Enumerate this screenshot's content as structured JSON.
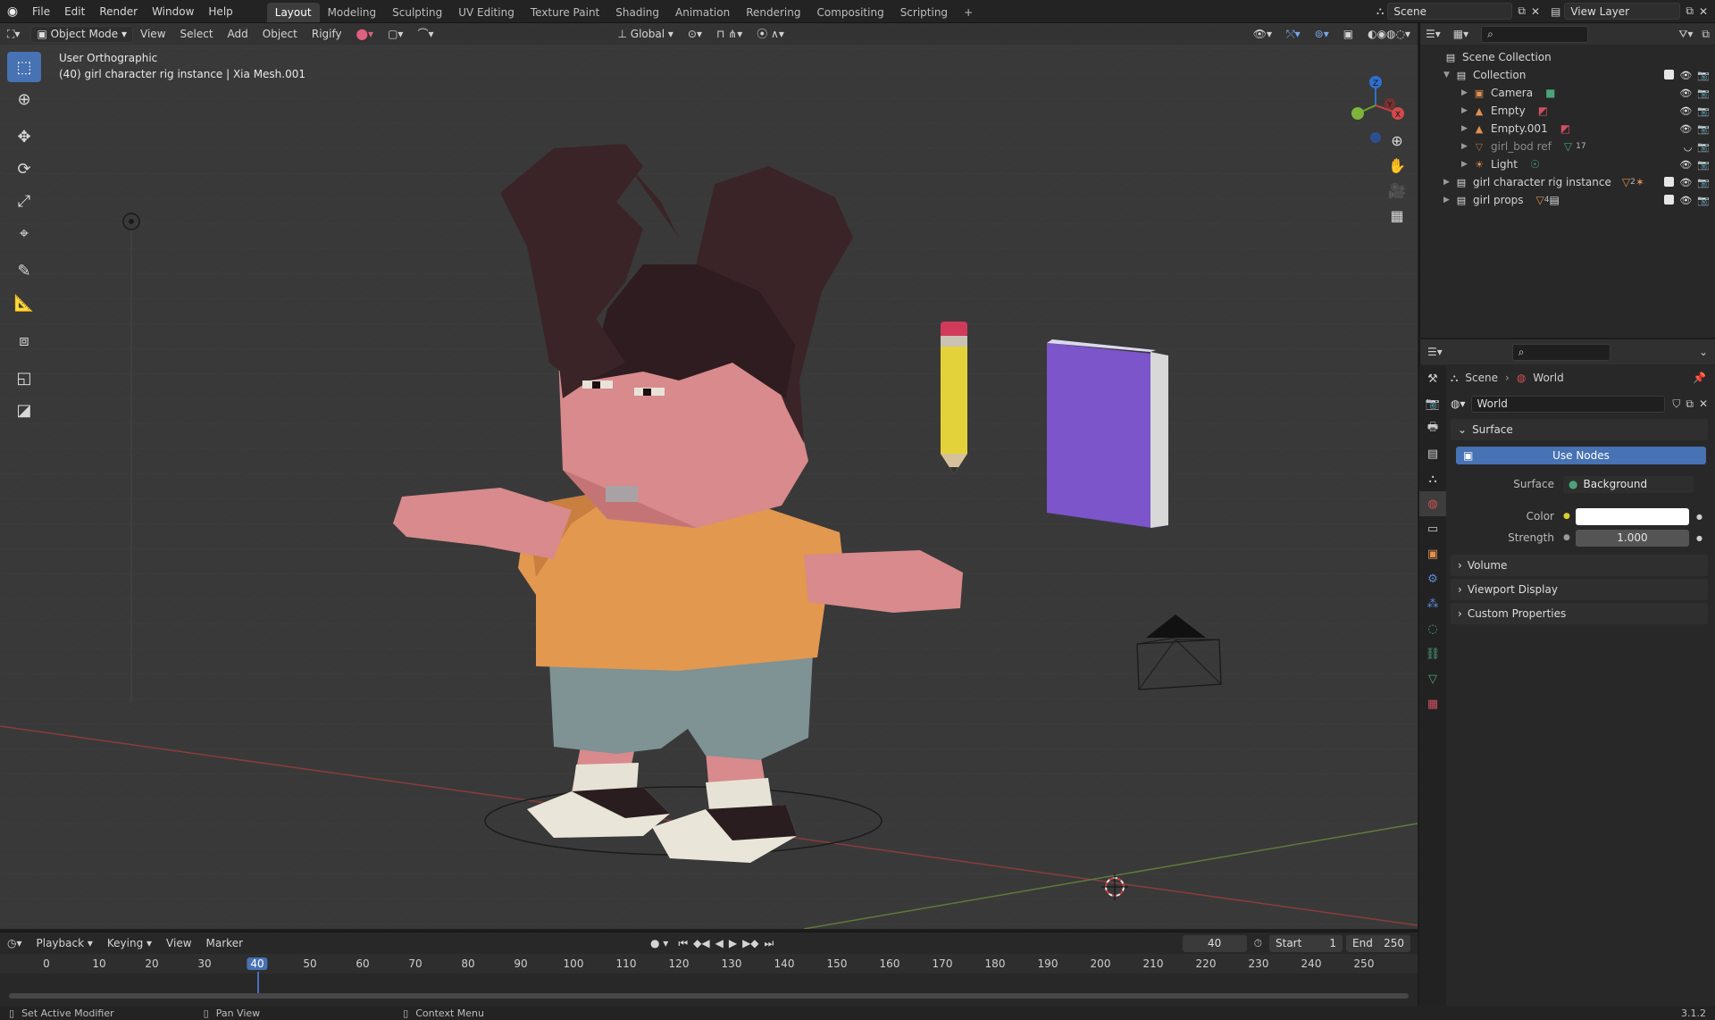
{
  "topbar": {
    "menus": [
      "File",
      "Edit",
      "Render",
      "Window",
      "Help"
    ],
    "workspaces": [
      "Layout",
      "Modeling",
      "Sculpting",
      "UV Editing",
      "Texture Paint",
      "Shading",
      "Animation",
      "Rendering",
      "Compositing",
      "Scripting"
    ],
    "active_workspace": "Layout",
    "add_workspace": "+",
    "scene": "Scene",
    "view_layer": "View Layer"
  },
  "viewport": {
    "mode": "Object Mode",
    "menus": [
      "View",
      "Select",
      "Add",
      "Object",
      "Rigify"
    ],
    "orientation": "Global",
    "view_name": "User Orthographic",
    "object_info": "(40) girl character rig instance | Xia Mesh.001",
    "gizmo": {
      "x": "X",
      "y": "Y",
      "z": "Z"
    }
  },
  "outliner": {
    "root": "Scene Collection",
    "items": [
      {
        "label": "Collection",
        "icon": "collection-icon",
        "level": 1,
        "expanded": true
      },
      {
        "label": "Camera",
        "icon": "camera-icon",
        "level": 2
      },
      {
        "label": "Empty",
        "icon": "empty-icon",
        "level": 2
      },
      {
        "label": "Empty.001",
        "icon": "empty-icon",
        "level": 2
      },
      {
        "label": "girl_bod ref",
        "icon": "mesh-icon",
        "level": 2,
        "badge": "17"
      },
      {
        "label": "Light",
        "icon": "light-icon",
        "level": 2
      },
      {
        "label": "girl character rig instance",
        "icon": "collection-icon",
        "level": 1,
        "badge": "2"
      },
      {
        "label": "girl props",
        "icon": "collection-icon",
        "level": 1,
        "badge": "4"
      }
    ]
  },
  "properties": {
    "breadcrumb": [
      "Scene",
      "World"
    ],
    "world_name": "World",
    "surface_panel": "Surface",
    "use_nodes": "Use Nodes",
    "surface_label": "Surface",
    "surface_value": "Background",
    "color_label": "Color",
    "color_value": "#ffffff",
    "strength_label": "Strength",
    "strength_value": "1.000",
    "panels": [
      "Volume",
      "Viewport Display",
      "Custom Properties"
    ]
  },
  "timeline": {
    "menus": [
      "Playback",
      "Keying",
      "View",
      "Marker"
    ],
    "current_frame": "40",
    "start_label": "Start",
    "start": "1",
    "end_label": "End",
    "end": "250",
    "ticks": [
      "0",
      "10",
      "20",
      "30",
      "40",
      "50",
      "60",
      "70",
      "80",
      "90",
      "100",
      "110",
      "120",
      "130",
      "140",
      "150",
      "160",
      "170",
      "180",
      "190",
      "200",
      "210",
      "220",
      "230",
      "240",
      "250"
    ]
  },
  "status": {
    "items": [
      "Set Active Modifier",
      "Pan View",
      "Context Menu"
    ],
    "version": "3.1.2"
  },
  "colors": {
    "accent": "#4772b3",
    "hair": "#3a2428",
    "skin": "#d88a8c",
    "shirt": "#e2984f",
    "shorts": "#7f9294",
    "book": "#7b55c9",
    "pencil": "#e4d23b"
  }
}
